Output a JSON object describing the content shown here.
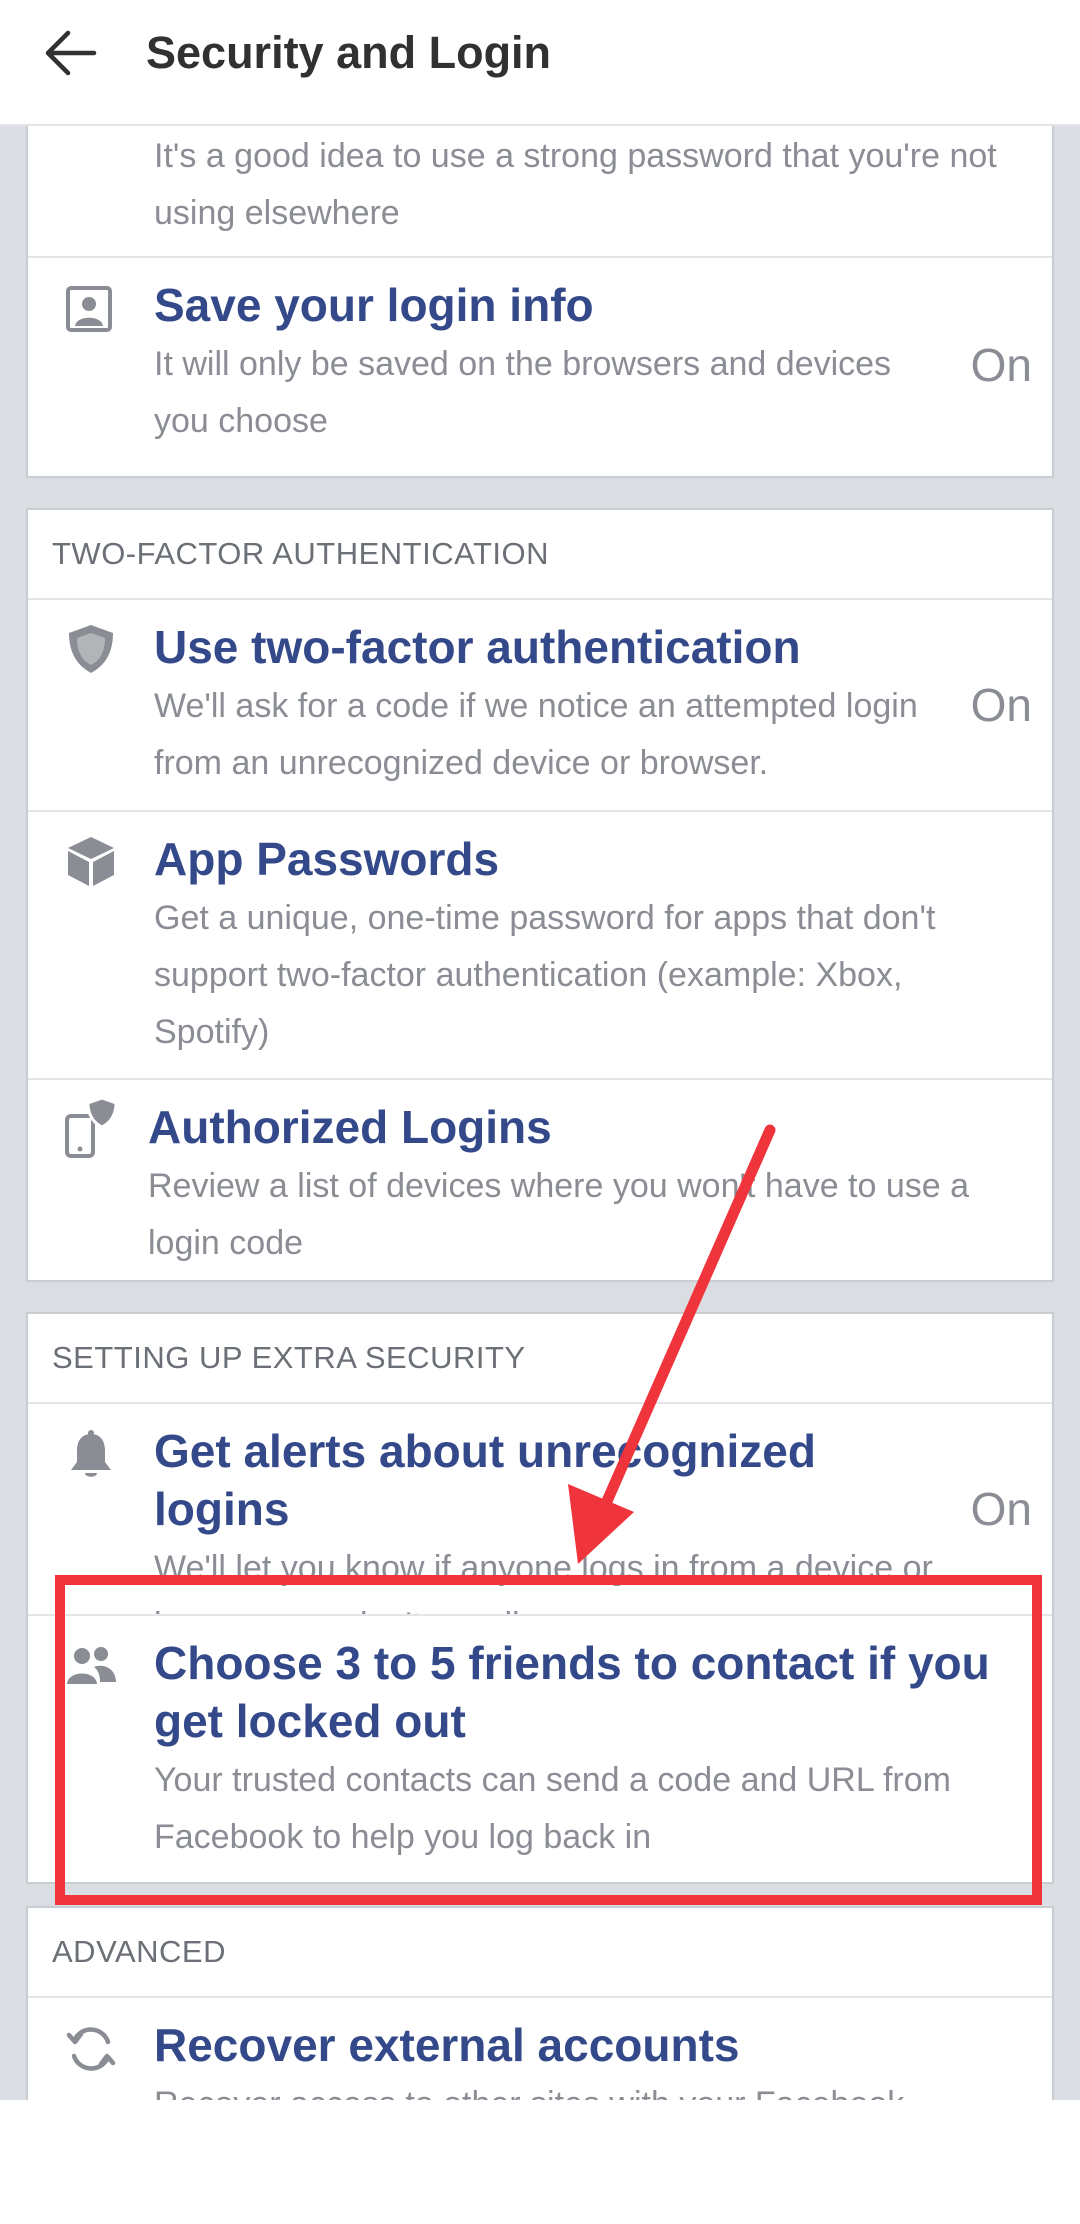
{
  "header": {
    "title": "Security and Login",
    "back_icon": "arrow-left-icon"
  },
  "password_section": {
    "desc": "It's a good idea to use a strong password that you're not using elsewhere"
  },
  "login_info": {
    "title": "Save your login info",
    "desc": "It will only be saved on the browsers and devices you choose",
    "state": "On",
    "icon": "portrait-card-icon"
  },
  "two_factor": {
    "header": "TWO-FACTOR AUTHENTICATION",
    "use_2fa": {
      "title": "Use two-factor authentication",
      "desc": "We'll ask for a code if we notice an attempted login from an unrecognized device or browser.",
      "state": "On",
      "icon": "shield-icon"
    },
    "app_passwords": {
      "title": "App Passwords",
      "desc": "Get a unique, one-time password for apps that don't support two-factor authentication (example: Xbox, Spotify)",
      "icon": "cube-icon"
    },
    "authorized_logins": {
      "title": "Authorized Logins",
      "desc": "Review a list of devices where you won't have to use a login code",
      "icon": "phone-shield-icon"
    }
  },
  "extra_security": {
    "header": "SETTING UP EXTRA SECURITY",
    "alerts": {
      "title": "Get alerts about unrecognized logins",
      "desc": "We'll let you know if anyone logs in from a device or browser you don't usually use",
      "state": "On",
      "icon": "bell-icon"
    },
    "trusted_contacts": {
      "title": "Choose 3 to 5 friends to contact if you get locked out",
      "desc": "Your trusted contacts can send a code and URL from Facebook to help you log back in",
      "icon": "friends-icon"
    }
  },
  "advanced": {
    "header": "ADVANCED",
    "recover": {
      "title": "Recover external accounts",
      "desc": "Recover access to other sites with your Facebook account",
      "icon": "refresh-icon"
    }
  },
  "annotation": {
    "color": "#f0343c",
    "shapes": [
      "highlight-rectangle",
      "pointer-arrow"
    ]
  }
}
